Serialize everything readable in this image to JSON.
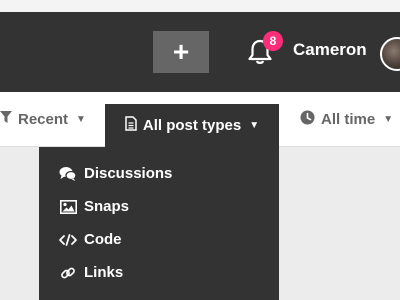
{
  "header": {
    "add_label": "+",
    "notification_count": "8",
    "username": "Cameron"
  },
  "filters": {
    "recent": "Recent",
    "post_types": "All post types",
    "time": "All time"
  },
  "dropdown": {
    "items": [
      {
        "label": "Discussions",
        "icon": "chat-bubbles-icon"
      },
      {
        "label": "Snaps",
        "icon": "image-icon"
      },
      {
        "label": "Code",
        "icon": "code-icon"
      },
      {
        "label": "Links",
        "icon": "link-icon"
      }
    ]
  },
  "colors": {
    "header_bg": "#333333",
    "badge": "#ff2d7a",
    "add_button_bg": "#666666"
  }
}
